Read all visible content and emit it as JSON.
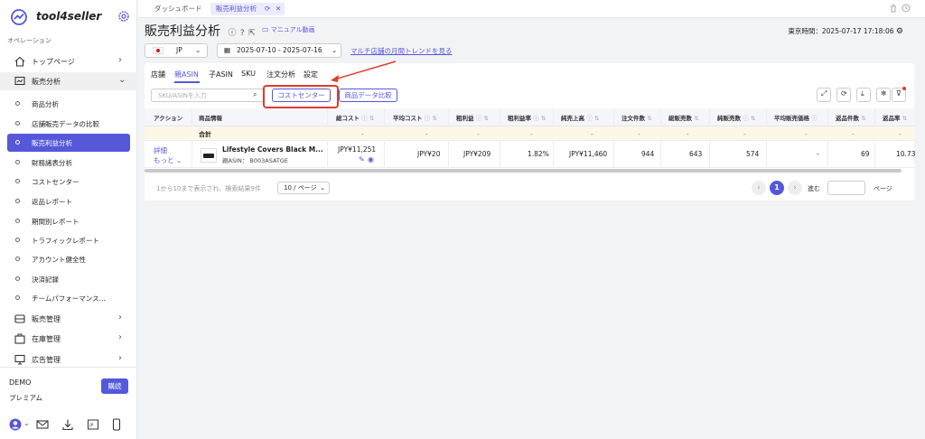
{
  "app": {
    "name": "tool4seller"
  },
  "sidebar": {
    "section_label": "オペレーション",
    "top_page": "トップページ",
    "sales_analysis": "販売分析",
    "sub_items": [
      {
        "label": "商品分析",
        "active": false
      },
      {
        "label": "店舗販売データの比較",
        "active": false
      },
      {
        "label": "販売利益分析",
        "active": true
      },
      {
        "label": "財務諸表分析",
        "active": false
      },
      {
        "label": "コストセンター",
        "active": false
      },
      {
        "label": "返品レポート",
        "active": false
      },
      {
        "label": "期間別レポート",
        "active": false
      },
      {
        "label": "トラフィックレポート",
        "active": false
      },
      {
        "label": "アカウント健全性",
        "active": false
      },
      {
        "label": "決済記録",
        "active": false
      },
      {
        "label": "チームパフォーマンス...",
        "active": false
      }
    ],
    "sales_management": "販売管理",
    "inventory_management": "在庫管理",
    "ad_management": "広告管理",
    "account_name": "DEMO",
    "plan": "プレミアム",
    "buy_label": "購読"
  },
  "topbar": {
    "tabs": [
      {
        "label": "ダッシュボード",
        "active": false
      },
      {
        "label": "販売利益分析",
        "active": true
      }
    ]
  },
  "header": {
    "title": "販売利益分析",
    "manual_label": "マニュアル動画",
    "sale_time_label": "東京時間：2025-07-17 17:18:06",
    "marketplace": "JP",
    "date_range": "2025-07-10 - 2025-07-16",
    "trend_link": "マルチ店舗の月間トレンドを見る"
  },
  "subtabs": [
    {
      "label": "店舗",
      "active": false
    },
    {
      "label": "親ASIN",
      "active": true
    },
    {
      "label": "子ASIN",
      "active": false
    },
    {
      "label": "SKU",
      "active": false
    },
    {
      "label": "注文分析",
      "active": false
    },
    {
      "label": "設定",
      "active": false
    }
  ],
  "toolbar": {
    "search_placeholder": "SKU/ASINを入力",
    "cost_center_label": "コストセンター",
    "compare_label": "商品データ比較"
  },
  "table": {
    "columns": [
      "アクション",
      "商品情報",
      "総コスト",
      "平均コスト",
      "粗利益",
      "粗利益率",
      "純売上高",
      "注文件数",
      "総販売数",
      "純販売数",
      "平均販売価格",
      "返品件数",
      "返品率"
    ],
    "total_row": {
      "label": "合計",
      "dash": "-"
    },
    "rows": [
      {
        "action_detail": "詳細",
        "action_more": "もっと",
        "product_title": "Lifestyle Covers Black M...",
        "parent_asin": "親ASIN： B003ASATGE",
        "total_cost": "JPY¥11,251",
        "avg_cost": "JPY¥20",
        "gross_profit": "JPY¥209",
        "gross_margin": "1.82%",
        "net_sales": "JPY¥11,460",
        "orders": "944",
        "total_units": "643",
        "net_units": "574",
        "avg_price": "-",
        "returns": "69",
        "return_rate": "10.73"
      }
    ]
  },
  "pagination": {
    "info": "1から10まで表示され、検索結果9件",
    "page_size": "10 / ページ",
    "current_page": "1",
    "goto_label": "進む",
    "page_label": "ページ"
  },
  "colors": {
    "accent": "#5558d9",
    "highlight": "#e03d2a"
  }
}
